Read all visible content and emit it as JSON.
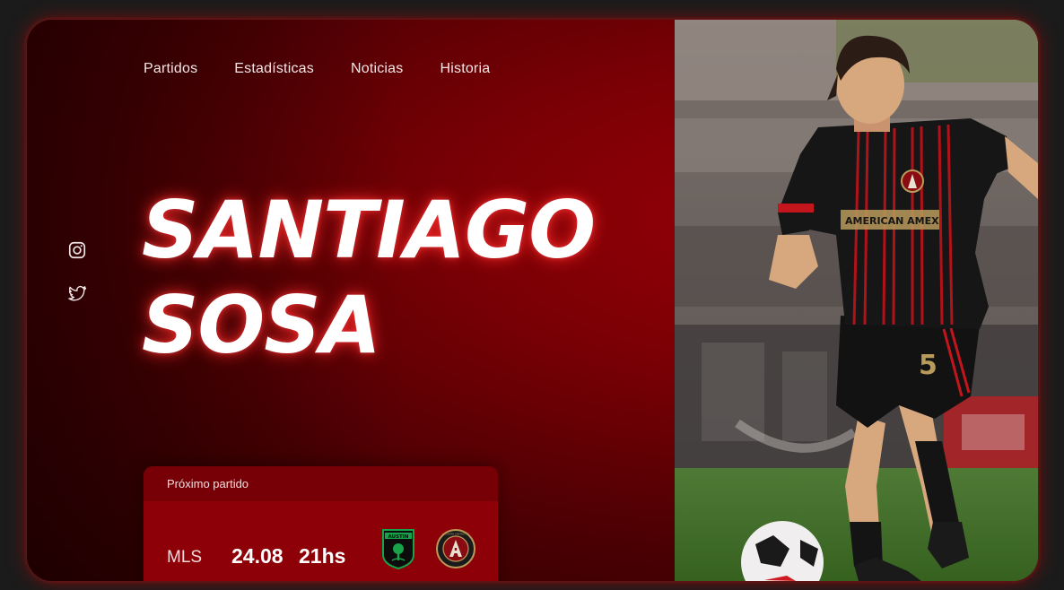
{
  "nav": {
    "items": [
      "Partidos",
      "Estadísticas",
      "Noticias",
      "Historia"
    ]
  },
  "social": {
    "icons": [
      "instagram-icon",
      "twitter-icon"
    ]
  },
  "hero": {
    "first_name": "SANTIAGO",
    "last_name": "SOSA"
  },
  "next_match": {
    "header": "Próximo partido",
    "league": "MLS",
    "date": "24.08",
    "time": "21hs",
    "home_crest_text": "AUSTIN",
    "away_crest_text": "ATLANTA UNITED FC"
  },
  "player_photo": {
    "jersey_number": "5",
    "sponsor": "AMERICAN AMEX"
  },
  "colors": {
    "background": "#1b1b1b",
    "accent_red": "#8d0008",
    "header_red": "#760006",
    "glow": "#ff2828",
    "austin_green": "#17a34a"
  }
}
